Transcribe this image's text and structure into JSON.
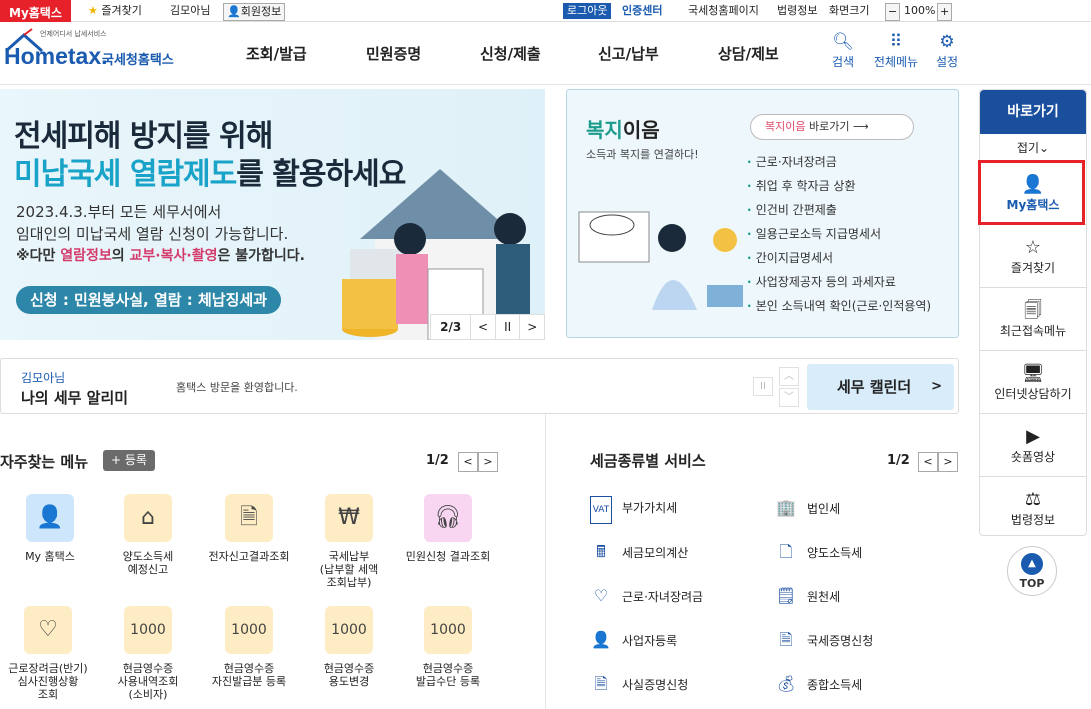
{
  "topbar": {
    "my_hometax": "My홈택스",
    "favorites": "즐겨찾기",
    "user_name": "김모아님",
    "member_info": "회원정보",
    "logout": "로그아웃",
    "cert_center": "인증센터",
    "nts_page": "국세청홈페이지",
    "law_info": "법령정보",
    "screen_size": "화면크기",
    "zoom": "100%",
    "zoom_out": "−",
    "zoom_in": "+"
  },
  "header": {
    "logo_small": "언제어디서 납세서비스",
    "logo_main": "Hometax.",
    "logo_sub": "국세청홈택스",
    "menu": [
      "조회/발급",
      "민원증명",
      "신청/제출",
      "신고/납부",
      "상담/제보"
    ],
    "icons": [
      {
        "label": "검색",
        "icon": "search-icon"
      },
      {
        "label": "전체메뉴",
        "icon": "grid-menu-icon"
      },
      {
        "label": "설정",
        "icon": "gear-icon"
      }
    ]
  },
  "banner_main": {
    "line1": "전세피해 방지를 위해",
    "line2_highlight": "미납국세 열람제도",
    "line2_rest": "를 활용하세요",
    "desc1": "2023.4.3.부터 모든 세무서에서",
    "desc2": "임대인의 미납국세 열람 신청이 가능합니다.",
    "desc3_pre": "※다만 ",
    "desc3_red1": "열람정보",
    "desc3_mid": "의 ",
    "desc3_red2": "교부·복사·촬영",
    "desc3_post": "은 불가합니다.",
    "pill": "신청 : 민원봉사실, 열람 : 체납징세과",
    "page": "2/3",
    "prev": "<",
    "pause": "II",
    "next": ">"
  },
  "banner_welfare": {
    "title_green": "복지",
    "title_rest": "이음",
    "subtitle": "소득과 복지를 연결하다!",
    "button_red": "복지이음",
    "button_rest": " 바로가기",
    "items": [
      "근로·자녀장려금",
      "취업 후 학자금 상환",
      "인건비 간편제출",
      "일용근로소득 지급명세서",
      "간이지급명세서",
      "사업장제공자 등의 과세자료",
      "본인 소득내역 확인(근로·인적용역)"
    ]
  },
  "quick": {
    "title": "바로가기",
    "fold": "접기⌄",
    "items": [
      {
        "label": "My홈택스",
        "icon": "person-icon"
      },
      {
        "label": "즐겨찾기",
        "icon": "star-icon"
      },
      {
        "label": "최근접속메뉴",
        "icon": "recent-menu-icon"
      },
      {
        "label": "인터넷상담하기",
        "icon": "consult-icon"
      },
      {
        "label": "숏폼영상",
        "icon": "play-icon"
      },
      {
        "label": "법령정보",
        "icon": "gavel-icon"
      }
    ],
    "top": "TOP"
  },
  "notice": {
    "user": "김모아님",
    "title": "나의 세무 알리미",
    "message": "홈택스 방문을 환영합니다.",
    "calendar": "세무 캘린더",
    "calendar_arrow": ">"
  },
  "favorites_menu": {
    "title": "자주찾는 메뉴",
    "register": "+ 등록",
    "page": "1/2",
    "items": [
      {
        "label": "My 홈택스",
        "icon": "person-icon",
        "color": "#cde6fb"
      },
      {
        "label": "양도소득세\n예정신고",
        "icon": "house-icon",
        "color": "#fdecc4"
      },
      {
        "label": "전자신고결과조회",
        "icon": "document-search-icon",
        "color": "#fdecc4"
      },
      {
        "label": "국세납부\n(납부할 세액\n조회납부)",
        "icon": "tax-pay-icon",
        "color": "#fdecc4"
      },
      {
        "label": "민원신청 결과조회",
        "icon": "headset-icon",
        "color": "#f8d6f2"
      },
      {
        "label": "근로장려금(반기)\n심사진행상황\n조회",
        "icon": "heart-search-icon",
        "color": "#fdecc4"
      },
      {
        "label": "현금영수증\n사용내역조회\n(소비자)",
        "icon": "receipt-icon",
        "color": "#fdecc4"
      },
      {
        "label": "현금영수증\n자진발급분 등록",
        "icon": "receipt-search-icon",
        "color": "#fdecc4"
      },
      {
        "label": "현금영수증\n용도변경",
        "icon": "receipt-change-icon",
        "color": "#fdecc4"
      },
      {
        "label": "현금영수증\n발급수단 등록",
        "icon": "receipt-register-icon",
        "color": "#fdecc4"
      }
    ]
  },
  "tax_service": {
    "title": "세금종류별 서비스",
    "page": "1/2",
    "items": [
      {
        "label": "부가가치세",
        "icon": "vat-icon"
      },
      {
        "label": "법인세",
        "icon": "building-icon"
      },
      {
        "label": "세금모의계산",
        "icon": "calculator-icon"
      },
      {
        "label": "양도소득세",
        "icon": "transfer-icon"
      },
      {
        "label": "근로·자녀장려금",
        "icon": "heart-icon"
      },
      {
        "label": "원천세",
        "icon": "withholding-icon"
      },
      {
        "label": "사업자등록",
        "icon": "person-icon"
      },
      {
        "label": "국세증명신청",
        "icon": "document-icon"
      },
      {
        "label": "사실증명신청",
        "icon": "document-icon"
      },
      {
        "label": "종합소득세",
        "icon": "money-bag-icon"
      }
    ]
  }
}
